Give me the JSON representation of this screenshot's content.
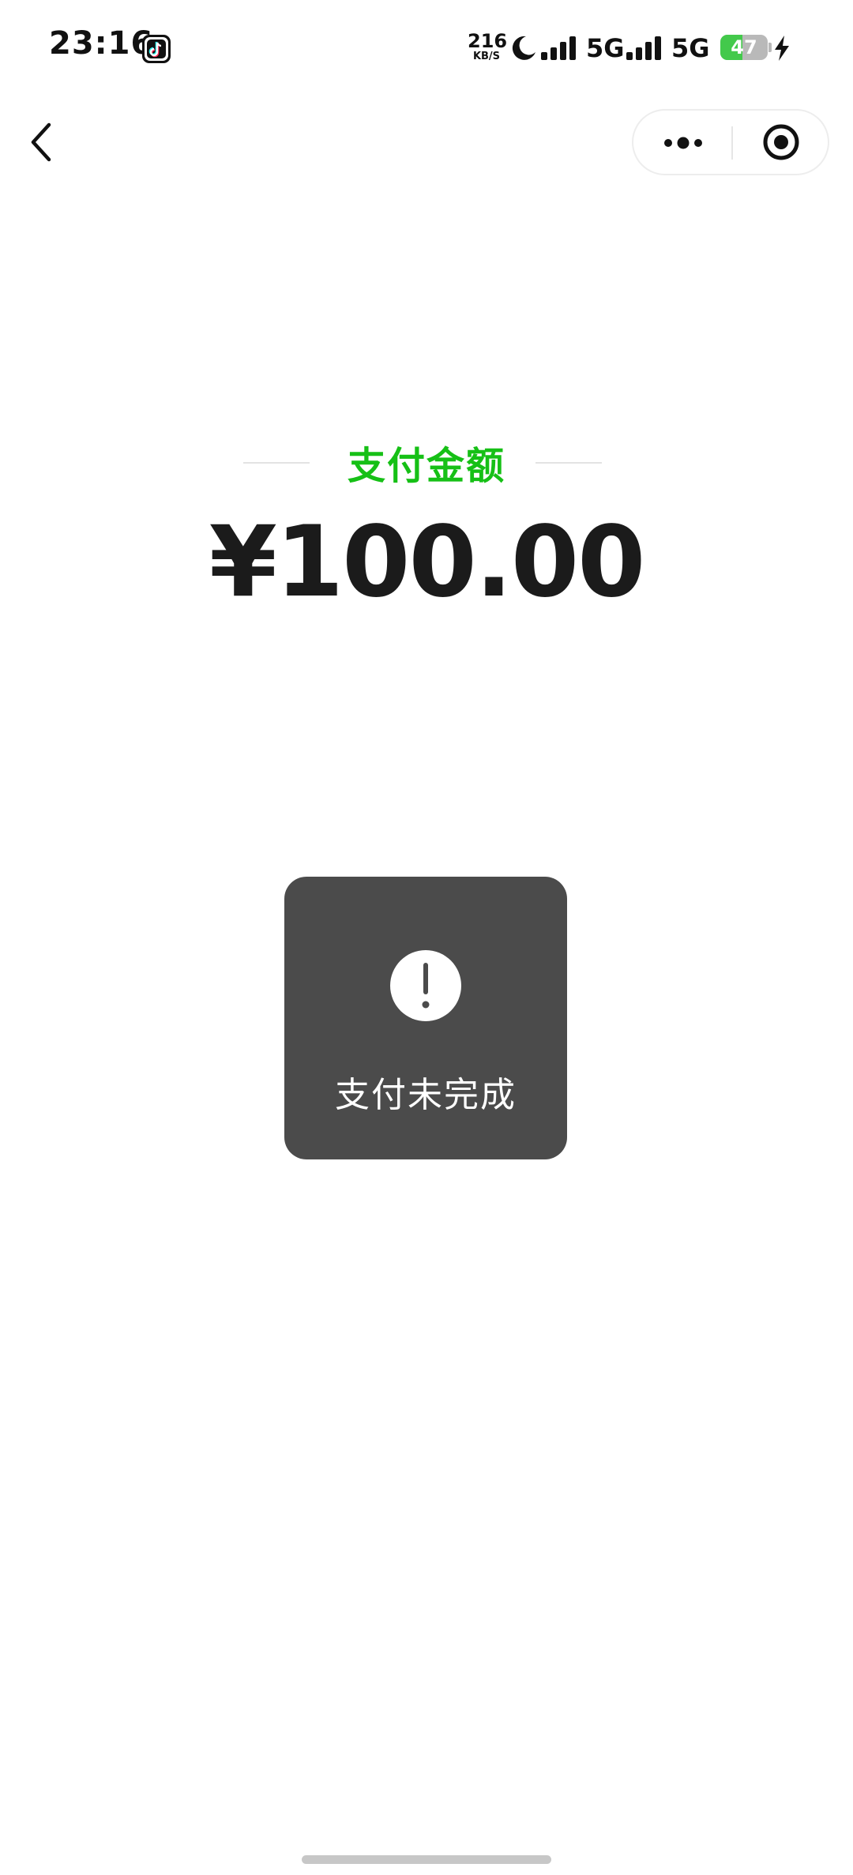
{
  "status_bar": {
    "time": "23:16",
    "app_icon": "tiktok-icon",
    "net_speed": "216",
    "net_unit": "KB/S",
    "dnd_icon": "moon-icon",
    "sim1_label": "5G",
    "sim2_label": "5G",
    "battery_level": "47",
    "charging_icon": "bolt-icon"
  },
  "nav": {
    "back_icon": "chevron-left-icon",
    "more_icon": "more-dots-icon",
    "close_icon": "target-close-icon"
  },
  "payment": {
    "label": "支付金额",
    "amount": "¥100.00"
  },
  "toast": {
    "icon": "exclamation-icon",
    "message": "支付未完成"
  },
  "colors": {
    "accent_green": "#16c016",
    "toast_bg": "#4b4b4b",
    "battery_green": "#43c94b"
  }
}
